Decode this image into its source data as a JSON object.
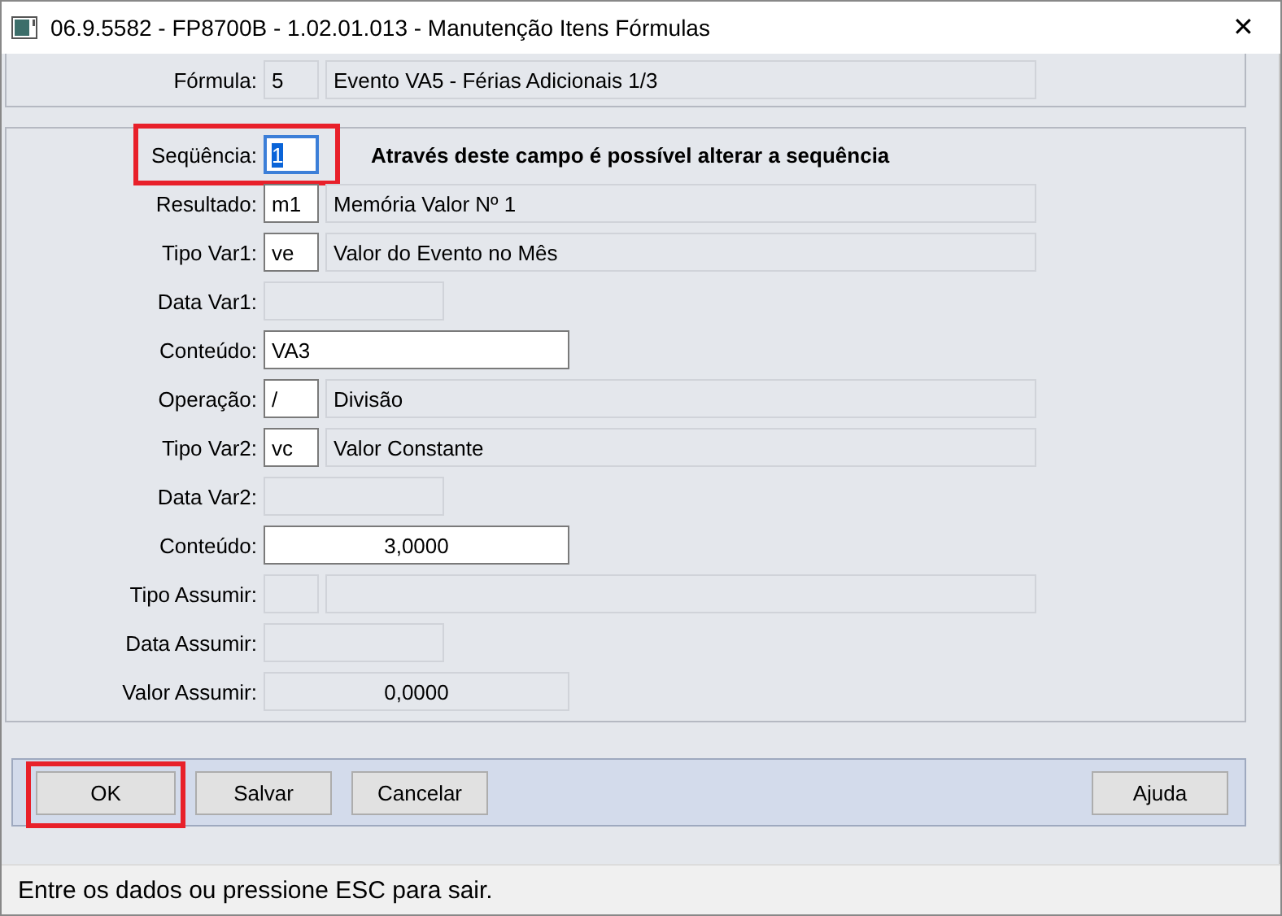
{
  "window": {
    "title": "06.9.5582 - FP8700B - 1.02.01.013 - Manutenção Itens Fórmulas",
    "close": "✕"
  },
  "formula": {
    "label": "Fórmula:",
    "fields": [
      {
        "kind": "code",
        "value": "5",
        "editable": false
      },
      {
        "kind": "desc",
        "value": "Evento VA5 - Férias Adicionais 1/3",
        "editable": false
      }
    ]
  },
  "rows": [
    {
      "label": "Seqüência:",
      "highlighted": true,
      "note": "Através deste campo é possível alterar a sequência",
      "fields": [
        {
          "kind": "code",
          "value": "1",
          "editable": true,
          "focused": true
        }
      ]
    },
    {
      "label": "Resultado:",
      "highlighted": false,
      "fields": [
        {
          "kind": "code",
          "value": "m1",
          "editable": true,
          "focused": false
        },
        {
          "kind": "desc",
          "value": "Memória Valor Nº 1",
          "editable": false
        }
      ]
    },
    {
      "label": "Tipo Var1:",
      "highlighted": false,
      "fields": [
        {
          "kind": "code",
          "value": "ve",
          "editable": true,
          "focused": false
        },
        {
          "kind": "desc",
          "value": "Valor do Evento no Mês",
          "editable": false
        }
      ]
    },
    {
      "label": "Data Var1:",
      "highlighted": false,
      "fields": [
        {
          "kind": "date",
          "editable": false
        }
      ]
    },
    {
      "label": "Conteúdo:",
      "highlighted": false,
      "fields": [
        {
          "kind": "content",
          "value": "VA3",
          "editable": true,
          "focused": false
        }
      ]
    },
    {
      "label": "Operação:",
      "highlighted": false,
      "fields": [
        {
          "kind": "code",
          "value": "/",
          "editable": true,
          "focused": false
        },
        {
          "kind": "desc",
          "value": "Divisão",
          "editable": false
        }
      ]
    },
    {
      "label": "Tipo Var2:",
      "highlighted": false,
      "fields": [
        {
          "kind": "code",
          "value": "vc",
          "editable": true,
          "focused": false
        },
        {
          "kind": "desc",
          "value": "Valor Constante",
          "editable": false
        }
      ]
    },
    {
      "label": "Data Var2:",
      "highlighted": false,
      "fields": [
        {
          "kind": "date",
          "editable": false
        }
      ]
    },
    {
      "label": "Conteúdo:",
      "highlighted": false,
      "fields": [
        {
          "kind": "number",
          "value": "3,0000",
          "editable": true,
          "focused": false
        }
      ]
    },
    {
      "label": "Tipo Assumir:",
      "highlighted": false,
      "fields": [
        {
          "kind": "code",
          "editable": false
        },
        {
          "kind": "desc",
          "editable": false
        }
      ]
    },
    {
      "label": "Data Assumir:",
      "highlighted": false,
      "fields": [
        {
          "kind": "date",
          "editable": false
        }
      ]
    },
    {
      "label": "Valor Assumir:",
      "highlighted": false,
      "fields": [
        {
          "kind": "number",
          "value": "0,0000",
          "editable": false
        }
      ]
    }
  ],
  "buttons_left": [
    {
      "label": "OK",
      "highlighted": true
    },
    {
      "label": "Salvar",
      "highlighted": false
    },
    {
      "label": "Cancelar",
      "highlighted": false
    }
  ],
  "buttons_right": [
    {
      "label": "Ajuda",
      "highlighted": false
    }
  ],
  "status_bar": "Entre os dados ou pressione ESC para sair."
}
